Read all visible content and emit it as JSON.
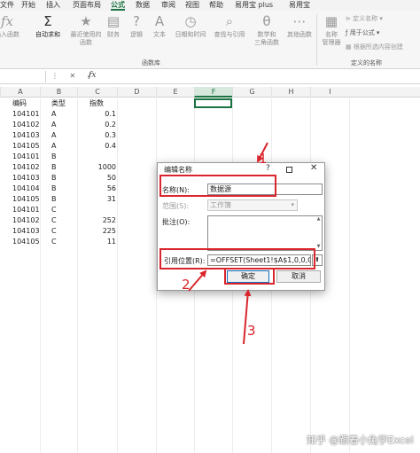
{
  "menubar": {
    "tabs": [
      "文件",
      "开始",
      "插入",
      "页面布局",
      "公式",
      "数据",
      "审阅",
      "视图",
      "帮助",
      "易用宝 plus",
      "易用宝"
    ],
    "active_tab": "公式"
  },
  "ribbon": {
    "buttons": [
      {
        "icon": "fx-icon",
        "glyph": "fx",
        "line1": "插入函数",
        "line2": ""
      },
      {
        "icon": "sigma-icon",
        "glyph": "Σ",
        "line1": "自动求和",
        "line2": ""
      },
      {
        "icon": "star-icon",
        "glyph": "★",
        "line1": "最近使用的",
        "line2": "函数"
      },
      {
        "icon": "finance-icon",
        "glyph": "▤",
        "line1": "财务",
        "line2": ""
      },
      {
        "icon": "logic-icon",
        "glyph": "?",
        "line1": "逻辑",
        "line2": ""
      },
      {
        "icon": "text-icon",
        "glyph": "A",
        "line1": "文本",
        "line2": ""
      },
      {
        "icon": "datetime-icon",
        "glyph": "◷",
        "line1": "日期和时间",
        "line2": ""
      },
      {
        "icon": "lookup-icon",
        "glyph": "⌕",
        "line1": "查找与引用",
        "line2": ""
      },
      {
        "icon": "math-icon",
        "glyph": "θ",
        "line1": "数学和",
        "line2": "三角函数"
      },
      {
        "icon": "more-functions-icon",
        "glyph": "⋯",
        "line1": "其他函数",
        "line2": ""
      },
      {
        "icon": "name-manager-icon",
        "glyph": "▦",
        "line1": "名称",
        "line2": "管理器"
      }
    ],
    "group_function_library": "函数库",
    "group_defined_names": "定义的名称",
    "define_name": "定义名称",
    "use_in_formula": "用于公式",
    "create_from_selection": "根据所选内容创建"
  },
  "formula_bar": {
    "fx_label": "fx",
    "icons": "⋮ ✕ ✓"
  },
  "grid": {
    "columns": [
      "A",
      "B",
      "C",
      "D",
      "E",
      "F",
      "G",
      "H",
      "I"
    ],
    "selected_column": "F",
    "rows": [
      [
        "编码",
        "类型",
        "指数"
      ],
      [
        "104101",
        "A",
        "0.1"
      ],
      [
        "104102",
        "A",
        "0.2"
      ],
      [
        "104103",
        "A",
        "0.3"
      ],
      [
        "104105",
        "A",
        "0.4"
      ],
      [
        "104101",
        "B",
        ""
      ],
      [
        "104102",
        "B",
        "1000"
      ],
      [
        "104103",
        "B",
        "50"
      ],
      [
        "104104",
        "B",
        "56"
      ],
      [
        "104105",
        "B",
        "31"
      ],
      [
        "104101",
        "C",
        ""
      ],
      [
        "104102",
        "C",
        "252"
      ],
      [
        "104103",
        "C",
        "225"
      ],
      [
        "104105",
        "C",
        "11"
      ]
    ]
  },
  "dialog": {
    "title": "编辑名称",
    "help": "?",
    "close": "✕",
    "name_label": "名称(N):",
    "name_value": "数据源",
    "scope_label": "范围(S):",
    "scope_value": "工作簿",
    "comment_label": "批注(O):",
    "ref_label": "引用位置(R):",
    "ref_value": "=OFFSET(Sheet1!$A$1,0,0,COU",
    "collapse_glyph": "⬆",
    "ok_label": "确定",
    "cancel_label": "取消"
  },
  "annotations": {
    "markers": [
      "1",
      "2",
      "3"
    ],
    "color": "#d9262c"
  },
  "colors": {
    "accent": "#1a7340"
  },
  "watermark": "知乎 @跟着小兔学Excel"
}
